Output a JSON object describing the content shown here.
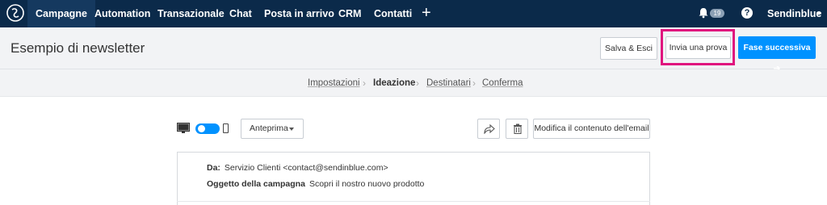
{
  "nav": {
    "items": [
      {
        "label": "Campagne",
        "active": true
      },
      {
        "label": "Automation"
      },
      {
        "label": "Transazionale"
      },
      {
        "label": "Chat"
      },
      {
        "label": "Posta in arrivo"
      },
      {
        "label": "CRM"
      },
      {
        "label": "Contatti"
      }
    ],
    "plus": "+",
    "notification_count": "19",
    "help": "?",
    "user": "Sendinblue"
  },
  "header": {
    "title": "Esempio di newsletter",
    "save_exit": "Salva & Esci",
    "send_test": "Invia una prova",
    "next_step": "Fase successiva ➔"
  },
  "stepper": {
    "steps": [
      "Impostazioni",
      "Ideazione",
      "Destinatari",
      "Conferma"
    ],
    "active_index": 1
  },
  "toolbar": {
    "preview": "Anteprima",
    "edit_content": "Modifica il contenuto dell'email"
  },
  "email": {
    "from_label": "Da:",
    "from_value": "Servizio Clienti <contact@sendinblue.com>",
    "subject_label": "Oggetto della campagna",
    "subject_value": "Scopri il nostro nuovo prodotto"
  },
  "colors": {
    "nav_bg": "#0b2a4a",
    "primary": "#0092ff",
    "highlight": "#e0147e"
  }
}
